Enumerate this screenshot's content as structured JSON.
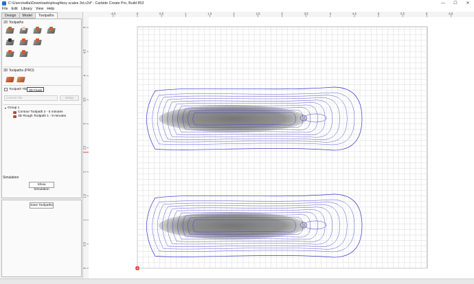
{
  "window": {
    "title": "C:\\Users\\willa\\Downloads\\ploughboy scales 3d.c2d* - Carbide Create Pro, Build 853",
    "minimize": "—",
    "maximize": "☐",
    "close": "✕"
  },
  "menu": [
    "File",
    "Edit",
    "Library",
    "View",
    "Help"
  ],
  "tabs": [
    {
      "label": "Design",
      "active": false
    },
    {
      "label": "Model",
      "active": false
    },
    {
      "label": "Toolpaths",
      "active": true
    }
  ],
  "toolpaths_2d": {
    "label": "2D Toolpaths",
    "icons": [
      "contour-toolpath-icon",
      "pocket-toolpath-icon",
      "advanced-vcarve-icon",
      "vcarve-icon",
      "drill-toolpath-icon",
      "texture-toolpath-icon",
      "rest-machining-icon",
      "engrave-toolpath-icon",
      "chamfer-toolpath-icon"
    ]
  },
  "toolpaths_3d": {
    "label": "3D Toolpaths (PRO)",
    "icons": [
      "3d-rough-icon",
      "3d-finish-icon"
    ]
  },
  "tiling": {
    "checkbox_label": "Toolpath Tilin",
    "tooltip": "3D Finish",
    "current_tile_placeholder": "Current Tile",
    "setup_label": "Setup"
  },
  "tree": {
    "group": "Group 1",
    "items": [
      {
        "label": "Contour Toolpath 2 - 5 minutes"
      },
      {
        "label": "3D Rough Toolpath 1 - 9 minutes"
      }
    ]
  },
  "simulation": {
    "label": "Simulation",
    "show_button": "Show Simulation",
    "save_button": "Save Toolpaths"
  },
  "ruler": {
    "top_labels": [
      "-0.5",
      "0",
      "0.5",
      "1",
      "1.5",
      "2",
      "2.5",
      "3",
      "3.5",
      "4",
      "4.5",
      "5",
      "5.5",
      "6",
      "6.5"
    ],
    "left_labels": [
      "5",
      "4.5",
      "4",
      "3.5",
      "3",
      "2.5",
      "2",
      "1.5",
      "1",
      "0.5",
      "0"
    ]
  },
  "colors": {
    "toolpath": "#3434c8",
    "grid": "#d8d8de",
    "grid_major": "#b8b8c4",
    "origin": "#d11818",
    "shading": "#7a7a7a"
  }
}
